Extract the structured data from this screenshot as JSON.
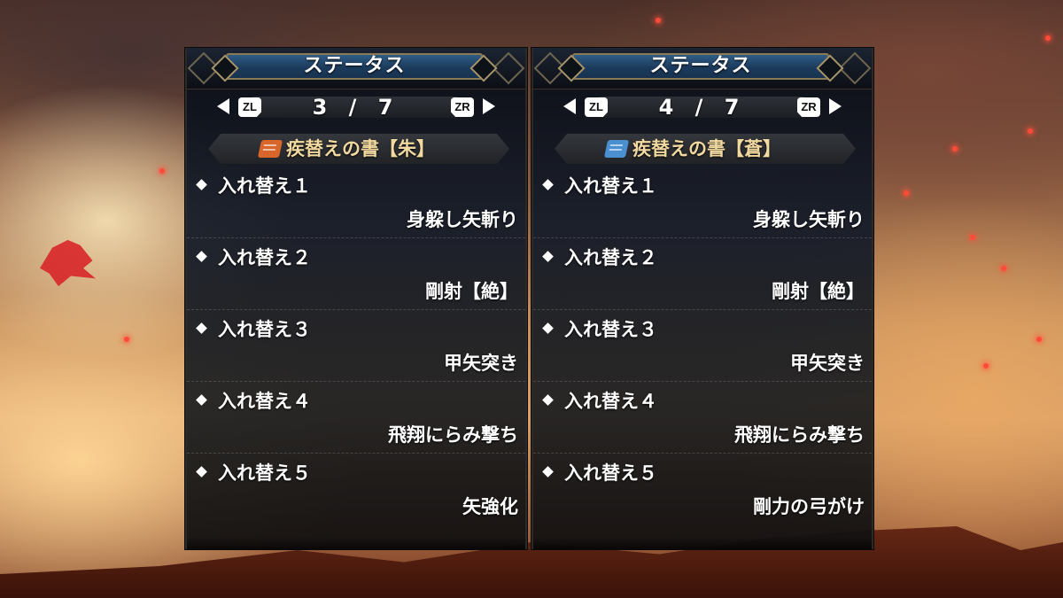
{
  "colors": {
    "title_plate": "#1c3b5c",
    "scroll_name_text": "#f1d9a0",
    "scroll_icon_crimson": "#d8652a",
    "scroll_icon_azure": "#4a8fd0",
    "ember": "#ff4a3a"
  },
  "panels": [
    {
      "title": "ステータス",
      "nav": {
        "left_button": "ZL",
        "right_button": "ZR",
        "page": "3 / 7"
      },
      "scroll": {
        "icon": "crimson-scroll-icon",
        "name": "疾替えの書【朱】"
      },
      "entries": [
        {
          "slot": "入れ替え１",
          "skill": "身躱し矢斬り"
        },
        {
          "slot": "入れ替え２",
          "skill": "剛射【絶】"
        },
        {
          "slot": "入れ替え３",
          "skill": "甲矢突き"
        },
        {
          "slot": "入れ替え４",
          "skill": "飛翔にらみ撃ち"
        },
        {
          "slot": "入れ替え５",
          "skill": "矢強化"
        }
      ]
    },
    {
      "title": "ステータス",
      "nav": {
        "left_button": "ZL",
        "right_button": "ZR",
        "page": "4 / 7"
      },
      "scroll": {
        "icon": "azure-scroll-icon",
        "name": "疾替えの書【蒼】"
      },
      "entries": [
        {
          "slot": "入れ替え１",
          "skill": "身躱し矢斬り"
        },
        {
          "slot": "入れ替え２",
          "skill": "剛射【絶】"
        },
        {
          "slot": "入れ替え３",
          "skill": "甲矢突き"
        },
        {
          "slot": "入れ替え４",
          "skill": "飛翔にらみ撃ち"
        },
        {
          "slot": "入れ替え５",
          "skill": "剛力の弓がけ"
        }
      ]
    }
  ]
}
